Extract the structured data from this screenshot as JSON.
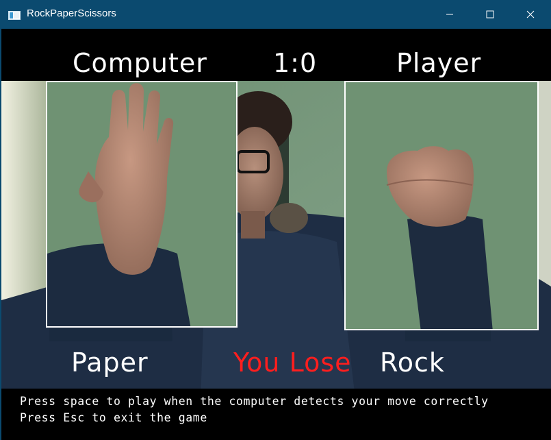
{
  "window": {
    "title": "RockPaperScissors",
    "icons": [
      "app-window-icon",
      "minimize-icon",
      "maximize-icon",
      "close-icon"
    ]
  },
  "scoreboard": {
    "computer_label": "Computer",
    "score": "1:0",
    "player_label": "Player"
  },
  "round": {
    "computer_move": "Paper",
    "result": "You Lose",
    "player_move": "Rock"
  },
  "instructions": {
    "line1": "Press space to play when the computer detects your move correctly",
    "line2": "Press Esc to exit the game"
  },
  "colors": {
    "titlebar": "#0b4a6f",
    "text": "#ffffff",
    "result_text": "#ff1e1e",
    "background": "#000000",
    "frame_border": "#ffffff"
  }
}
